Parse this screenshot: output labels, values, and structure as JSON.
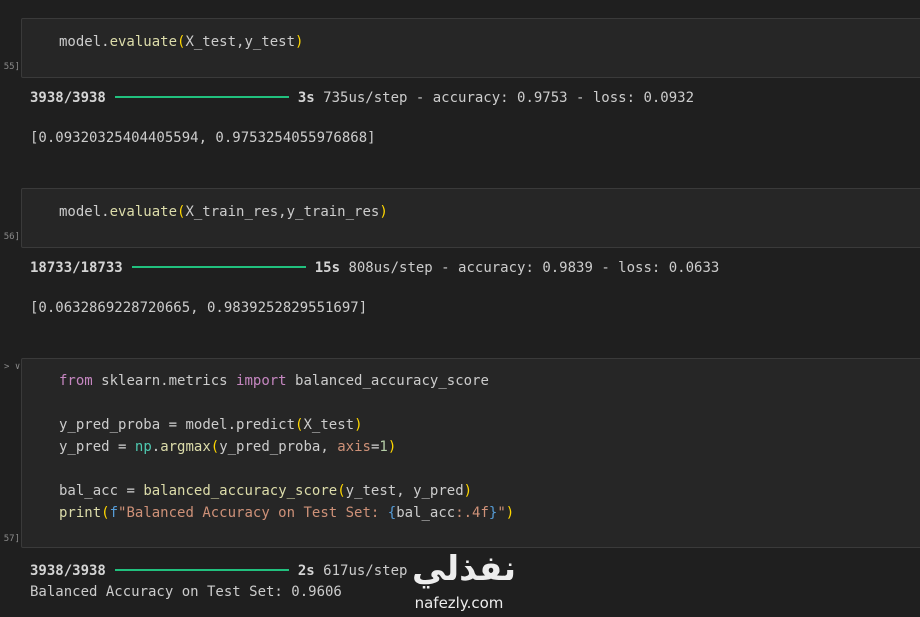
{
  "cells": [
    {
      "exec_count": "55]",
      "code": [
        "model.evaluate(X_test,y_test)"
      ]
    },
    {
      "exec_count": "56]",
      "code": [
        "model.evaluate(X_train_res,y_train_res)"
      ]
    },
    {
      "exec_count": "57]",
      "collapse_arrow": "> ∨"
    }
  ],
  "outputs": {
    "cell1": {
      "progress_steps": "3938/3938",
      "progress_fraction": 1.0,
      "time": "3s",
      "rest": "735us/step - accuracy: 0.9753 - loss: 0.0932",
      "result": "[0.09320325404405594, 0.9753254055976868]"
    },
    "cell2": {
      "progress_steps": "18733/18733",
      "progress_fraction": 1.0,
      "time": "15s",
      "rest": "808us/step - accuracy: 0.9839 - loss: 0.0633",
      "result": "[0.0632869228720665, 0.9839252829551697]"
    },
    "cell3": {
      "progress_steps": "3938/3938",
      "progress_fraction": 1.0,
      "time": "2s",
      "rest": "617us/step",
      "result": "Balanced Accuracy on Test Set: 0.9606"
    }
  },
  "code3": {
    "kw_from": "from",
    "module": "sklearn.metrics",
    "kw_import": "import",
    "imported": "balanced_accuracy_score",
    "v_proba": "y_pred_proba",
    "eq": "=",
    "model_predict": "model.predict",
    "p_open": "(",
    "x_test": "X_test",
    "p_close": ")",
    "v_pred": "y_pred",
    "np": "np",
    "dot": ".",
    "argmax": "argmax",
    "arg_proba": "y_pred_proba",
    "comma": ", ",
    "axis": "axis",
    "one": "1",
    "v_bal": "bal_acc",
    "bal_fn": "balanced_accuracy_score",
    "y_test": "y_test",
    "y_pred_arg": "y_pred",
    "print": "print",
    "f_prefix": "f",
    "str1": "\"Balanced Accuracy on Test Set: ",
    "brace_open": "{",
    "bal_var": "bal_acc",
    "fmt": ":.4f",
    "brace_close": "}",
    "str2": "\""
  },
  "colors": {
    "background": "#1f1f1f",
    "cell_background": "#262626",
    "progress_bar": "#21c07e"
  },
  "watermark": {
    "arabic": "نفذلي",
    "latin": "nafezly.com"
  }
}
